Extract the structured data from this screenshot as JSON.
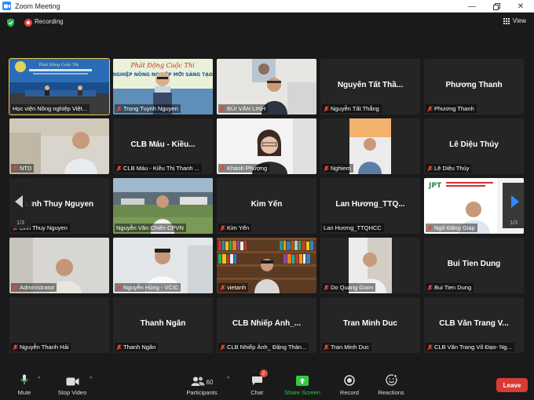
{
  "window": {
    "title": "Zoom Meeting"
  },
  "topbar": {
    "recording_label": "Recording",
    "view_label": "View"
  },
  "pager": {
    "left_page": "1/3",
    "right_page": "1/3"
  },
  "tiles": [
    {
      "big": "",
      "label": "Học viện Nông nghiệp Việt...",
      "muted": false,
      "active": true
    },
    {
      "big": "",
      "label": "Trọng Tuynh Nguyen",
      "muted": true
    },
    {
      "big": "",
      "label": "BÙI VĂN LINH",
      "muted": true
    },
    {
      "big": "Nguyễn Tất Thầ...",
      "label": "Nguyễn Tất Thắng",
      "muted": true
    },
    {
      "big": "Phương Thanh",
      "label": "Phương Thanh",
      "muted": true
    },
    {
      "big": "",
      "label": "NTD",
      "muted": true
    },
    {
      "big": "CLB Máu - Kiều...",
      "label": "CLB Máu - Kiều Thị Thanh ...",
      "muted": true
    },
    {
      "big": "",
      "label": "Khánh Phượng",
      "muted": true
    },
    {
      "big": "",
      "label": "Nghiem",
      "muted": true
    },
    {
      "big": "Lê Diệu Thúy",
      "label": "Lê Diệu Thúy",
      "muted": true
    },
    {
      "big": "Linh Thuy Nguyen",
      "label": "Linh Thuy Nguyen",
      "muted": true
    },
    {
      "big": "",
      "label": "Nguyễn Văn Chiến CPVN",
      "muted": false
    },
    {
      "big": "Kim Yến",
      "label": "Kim Yến",
      "muted": true
    },
    {
      "big": "Lan Hương_TTQ...",
      "label": "Lan Hương_TTQHCC",
      "muted": false
    },
    {
      "big": "",
      "label": "Ngô Đăng Giáp",
      "muted": true
    },
    {
      "big": "",
      "label": "Administrator",
      "muted": true
    },
    {
      "big": "",
      "label": "Nguyễn Hùng - VCIC",
      "muted": true
    },
    {
      "big": "",
      "label": "vietanh",
      "muted": true
    },
    {
      "big": "",
      "label": "Do Quang Giam",
      "muted": true
    },
    {
      "big": "Bui Tien Dung",
      "label": "Bui Tien Dung",
      "muted": true
    },
    {
      "big": "",
      "label": "Nguyễn Thanh Hải",
      "muted": true
    },
    {
      "big": "Thanh Ngân",
      "label": "Thanh Ngân",
      "muted": true
    },
    {
      "big": "CLB Nhiếp Ảnh_...",
      "label": "CLB Nhiếp Ảnh_ Đặng Thàn...",
      "muted": true
    },
    {
      "big": "Tran Minh Duc",
      "label": "Tran Minh Duc",
      "muted": true
    },
    {
      "big": "CLB Văn Trang V...",
      "label": "CLB Văn Trang Võ Đạo- Ng...",
      "muted": true
    }
  ],
  "toolbar": {
    "mute": "Mute",
    "stop_video": "Stop Video",
    "participants": "Participants",
    "participants_count": "60",
    "chat": "Chat",
    "chat_badge": "2",
    "share_screen": "Share Screen",
    "record": "Record",
    "reactions": "Reactions",
    "leave": "Leave"
  },
  "colors": {
    "share_green": "#2ecc40",
    "leave_red": "#d73b34",
    "active_yellow": "#e9c84a"
  }
}
